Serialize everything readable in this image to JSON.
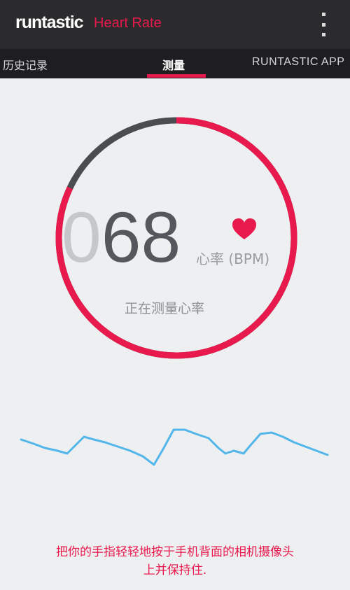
{
  "app": {
    "brand": "runtastic",
    "title": "Heart Rate",
    "menu_icon": "overflow-menu-icon"
  },
  "tabs": [
    {
      "label": "历史记录",
      "selected": false
    },
    {
      "label": "测量",
      "selected": true
    },
    {
      "label": "RUNTASTIC APP",
      "selected": false
    }
  ],
  "measurement": {
    "leading_digit": "0",
    "value": "68",
    "unit_label": "心率 (BPM)",
    "status": "正在测量心率",
    "progress": 0.82,
    "heart_icon": "heart-icon"
  },
  "colors": {
    "accent": "#e8194c",
    "ring_track": "#4a4c50",
    "wave": "#52b6ea",
    "appbar": "#2b2b2e"
  },
  "instruction": {
    "line1": "把你的手指轻轻地按于手机背面的相机摄像头",
    "line2": "上并保持住."
  }
}
